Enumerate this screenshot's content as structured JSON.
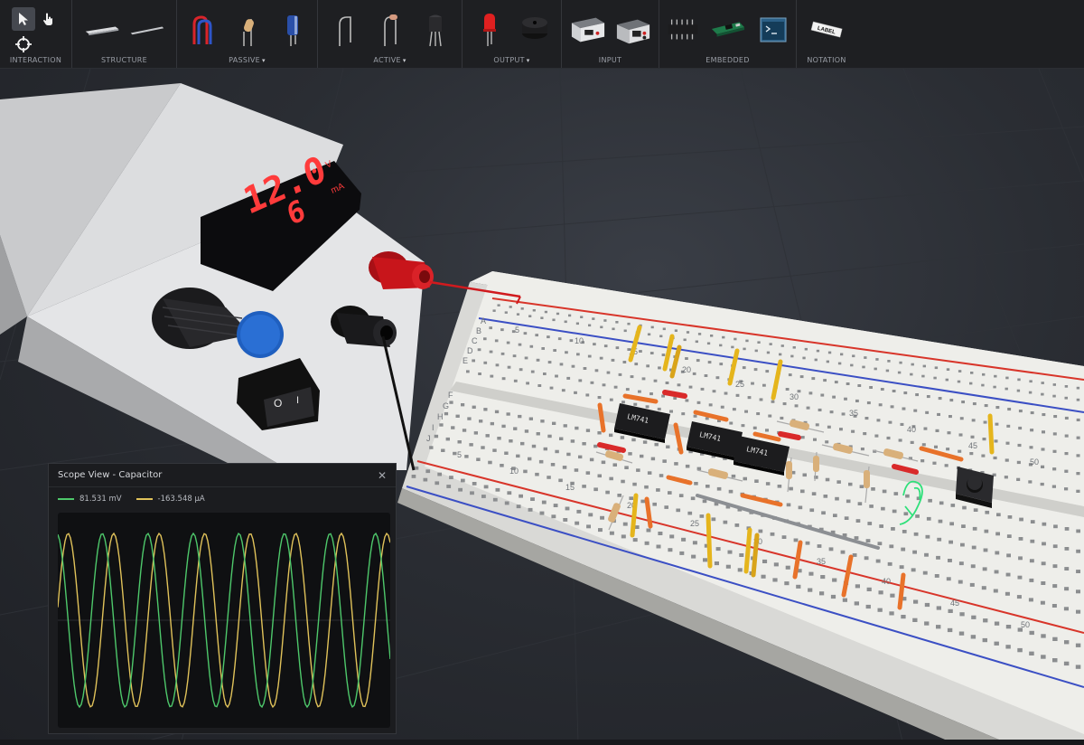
{
  "toolbar": {
    "groups": [
      {
        "label": "INTERACTION",
        "has_dropdown": false
      },
      {
        "label": "STRUCTURE",
        "has_dropdown": false
      },
      {
        "label": "PASSIVE",
        "has_dropdown": true
      },
      {
        "label": "ACTIVE",
        "has_dropdown": true
      },
      {
        "label": "OUTPUT",
        "has_dropdown": true
      },
      {
        "label": "INPUT",
        "has_dropdown": false
      },
      {
        "label": "EMBEDDED",
        "has_dropdown": false
      },
      {
        "label": "NOTATION",
        "has_dropdown": false
      }
    ],
    "label_tool_text": "LABEL",
    "caret": "▾"
  },
  "power_supply": {
    "voltage_display": "12.0",
    "voltage_unit": "V",
    "current_display": "6",
    "current_unit": "mA",
    "switch_off": "O",
    "switch_on": "I"
  },
  "breadboard": {
    "row_letters": [
      "A",
      "B",
      "C",
      "D",
      "E",
      "F",
      "G",
      "H",
      "I",
      "J"
    ],
    "top_numbers": [
      "5",
      "10",
      "15",
      "20",
      "25",
      "30",
      "35",
      "40",
      "45",
      "50"
    ],
    "bottom_numbers": [
      "5",
      "10",
      "15",
      "20",
      "25",
      "30",
      "35",
      "40",
      "45",
      "50"
    ],
    "chips": [
      "LM741",
      "LM741",
      "LM741"
    ]
  },
  "scope": {
    "title": "Scope View - Capacitor",
    "close_icon": "close-icon",
    "channels": [
      {
        "value": "81.531 mV",
        "color": "#4ec86b"
      },
      {
        "value": "-163.548 μA",
        "color": "#e0c25a"
      }
    ]
  },
  "status_text": "",
  "colors": {
    "toolbar_bg": "#1e1f22",
    "voltage_led": "#ff3b3b",
    "knob_blue": "#1f5fbf",
    "terminal_red": "#c8151b",
    "rail_red": "#d8352a",
    "rail_blue": "#3b4fc4"
  }
}
